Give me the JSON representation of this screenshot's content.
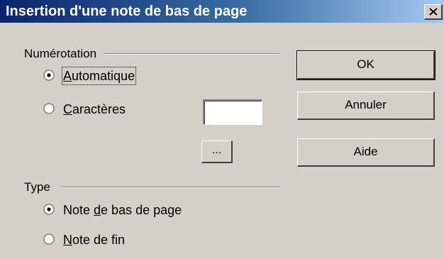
{
  "window": {
    "title": "Insertion d'une note de bas de page",
    "close_icon": "close-icon"
  },
  "numbering": {
    "group_label": "Numérotation",
    "automatic_label": "Automatique",
    "automatic_checked": true,
    "characters_label": "Caractères",
    "characters_checked": false,
    "characters_value": "",
    "browse_button_label": "..."
  },
  "type": {
    "group_label": "Type",
    "footnote_label": "Note de bas de page",
    "footnote_checked": true,
    "endnote_label": "Note de fin",
    "endnote_checked": false
  },
  "buttons": {
    "ok_label": "OK",
    "cancel_label": "Annuler",
    "help_label": "Aide"
  }
}
